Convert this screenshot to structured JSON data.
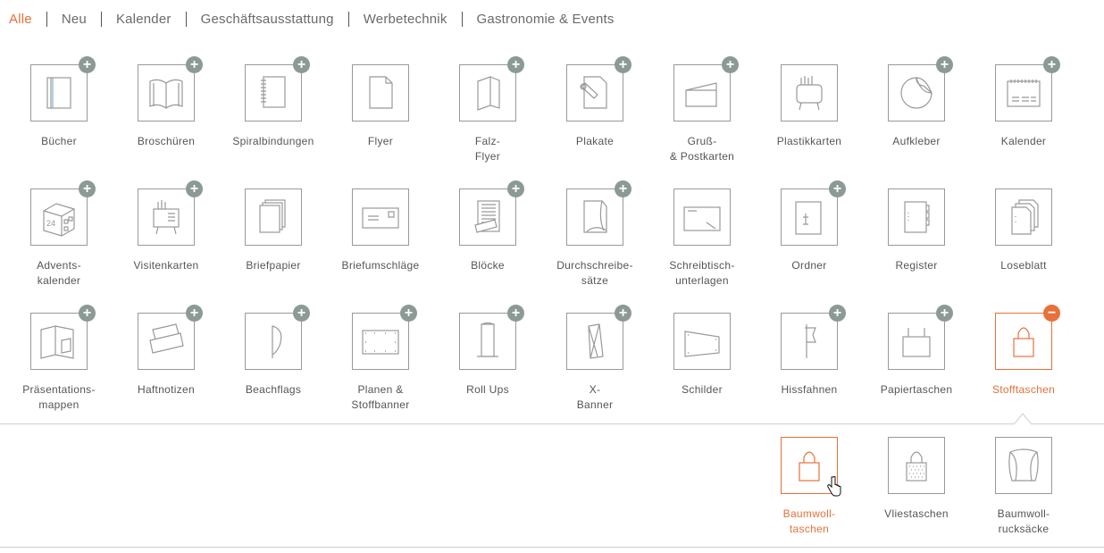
{
  "nav": {
    "tabs": [
      {
        "label": "Alle",
        "active": true
      },
      {
        "label": "Neu"
      },
      {
        "label": "Kalender"
      },
      {
        "label": "Geschäftsausstattung"
      },
      {
        "label": "Werbetechnik"
      },
      {
        "label": "Gastronomie & Events"
      }
    ]
  },
  "products": [
    {
      "label": "Bücher",
      "icon": "book-icon",
      "expand": "+"
    },
    {
      "label": "Broschüren",
      "icon": "brochure-icon",
      "expand": "+"
    },
    {
      "label": "Spiralbindungen",
      "icon": "spiral-binding-icon",
      "expand": "+"
    },
    {
      "label": "Flyer",
      "icon": "flyer-icon"
    },
    {
      "label": "Falz-Flyer",
      "icon": "folded-flyer-icon",
      "expand": "+"
    },
    {
      "label": "Plakate",
      "icon": "poster-icon",
      "expand": "+"
    },
    {
      "label": "Gruß- & Postkarten",
      "icon": "greeting-card-icon",
      "expand": "+"
    },
    {
      "label": "Plastikkarten",
      "icon": "plastic-card-icon"
    },
    {
      "label": "Aufkleber",
      "icon": "sticker-icon",
      "expand": "+"
    },
    {
      "label": "Kalender",
      "icon": "calendar-icon",
      "expand": "+"
    },
    {
      "label": "Advents-kalender",
      "icon": "advent-calendar-icon",
      "expand": "+"
    },
    {
      "label": "Visitenkarten",
      "icon": "business-card-icon",
      "expand": "+"
    },
    {
      "label": "Briefpapier",
      "icon": "letterhead-icon"
    },
    {
      "label": "Briefumschläge",
      "icon": "envelope-icon"
    },
    {
      "label": "Blöcke",
      "icon": "notepad-icon",
      "expand": "+"
    },
    {
      "label": "Durchschreibe-sätze",
      "icon": "carbon-copy-icon",
      "expand": "+"
    },
    {
      "label": "Schreibtisch-unterlagen",
      "icon": "desk-pad-icon"
    },
    {
      "label": "Ordner",
      "icon": "folder-binder-icon",
      "expand": "+"
    },
    {
      "label": "Register",
      "icon": "register-icon"
    },
    {
      "label": "Loseblatt",
      "icon": "loose-leaf-icon"
    },
    {
      "label": "Präsentations-mappen",
      "icon": "presentation-folder-icon",
      "expand": "+"
    },
    {
      "label": "Haftnotizen",
      "icon": "sticky-note-icon",
      "expand": "+"
    },
    {
      "label": "Beachflags",
      "icon": "beach-flag-icon",
      "expand": "+"
    },
    {
      "label": "Planen & Stoffbanner",
      "icon": "banner-tarp-icon",
      "expand": "+"
    },
    {
      "label": "Roll Ups",
      "icon": "roll-up-icon",
      "expand": "+"
    },
    {
      "label": "X-Banner",
      "icon": "x-banner-icon",
      "expand": "+"
    },
    {
      "label": "Schilder",
      "icon": "sign-icon"
    },
    {
      "label": "Hissfahnen",
      "icon": "hoist-flag-icon",
      "expand": "+"
    },
    {
      "label": "Papiertaschen",
      "icon": "paper-bag-icon",
      "expand": "+"
    },
    {
      "label": "Stofftaschen",
      "icon": "cloth-bag-icon",
      "expand": "−",
      "selected": true
    }
  ],
  "subproducts": [
    {
      "label": "Baumwoll-taschen",
      "icon": "cotton-bag-icon",
      "selected": true
    },
    {
      "label": "Vliestaschen",
      "icon": "fleece-bag-icon"
    },
    {
      "label": "Baumwoll-rucksäcke",
      "icon": "cotton-backpack-icon"
    }
  ],
  "colors": {
    "accent": "#e8703a",
    "badge": "#8c9a96",
    "icon_stroke": "#999999",
    "text": "#555555"
  }
}
